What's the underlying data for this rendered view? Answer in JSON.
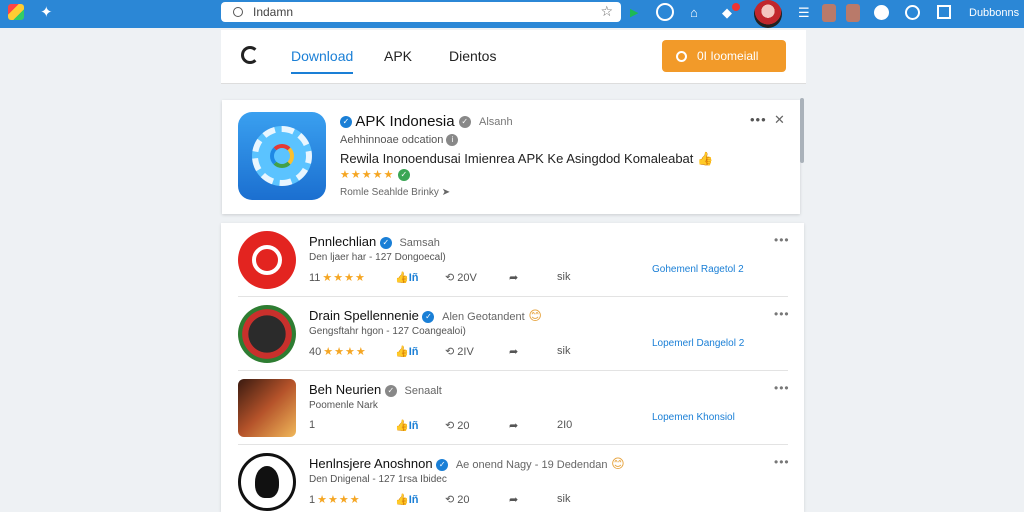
{
  "browser": {
    "address_text": "Indamn",
    "profile_label": "Dubbonns",
    "star": "☆"
  },
  "nav": {
    "tabs": [
      "Download",
      "APK",
      "Dientos"
    ],
    "button_label": "0I Ioomeiall"
  },
  "featured": {
    "title": "APK Indonesia",
    "handle": "Alsanh",
    "subtitle": "Aehhinnoae odcation",
    "description": "Rewila Inonoendusai Imienrea APK Ke Asingdod Komaleabat",
    "stars": "★★★★★",
    "small_text": "Romle Seahlde Brinky"
  },
  "apps": [
    {
      "name": "Pnnlechlian",
      "author": "Samsah",
      "sub": "Den ljaer har - 127 Dongoecal)",
      "rating": "11",
      "stars": "★★★★",
      "likes": "Iñ",
      "reposts": "20V",
      "shares": "sik",
      "link": "Gohemenl Ragetol 2",
      "icon_color": "#e32420"
    },
    {
      "name": "Drain Spellennenie",
      "author": "Alen Geotandent",
      "sub": "Gengsftahr hgon - 127 Coangealoi)",
      "rating": "40",
      "stars": "★★★★",
      "likes": "Iñ",
      "reposts": "2IV",
      "shares": "sik",
      "link": "Lopemerl Dangelol 2",
      "icon_color": "#1a1a1a"
    },
    {
      "name": "Beh Neurien",
      "author": "Senaalt",
      "sub": "Poomenle Nark",
      "rating": "1",
      "stars": "",
      "likes": "Iñ",
      "reposts": "20",
      "shares": "2I0",
      "link": "Lopemen Khonsiol",
      "icon_color": "#8a3a1e"
    },
    {
      "name": "Henlnsjere Anoshnon",
      "author": "Ae onend Nagy - 19 Dedendan",
      "sub": "Den Dnigenal - 127 1rsa Ibidec",
      "rating": "1",
      "stars": "★★★★",
      "likes": "Iñ",
      "reposts": "20",
      "shares": "sik",
      "link": "",
      "icon_color": "#ffffff"
    }
  ]
}
